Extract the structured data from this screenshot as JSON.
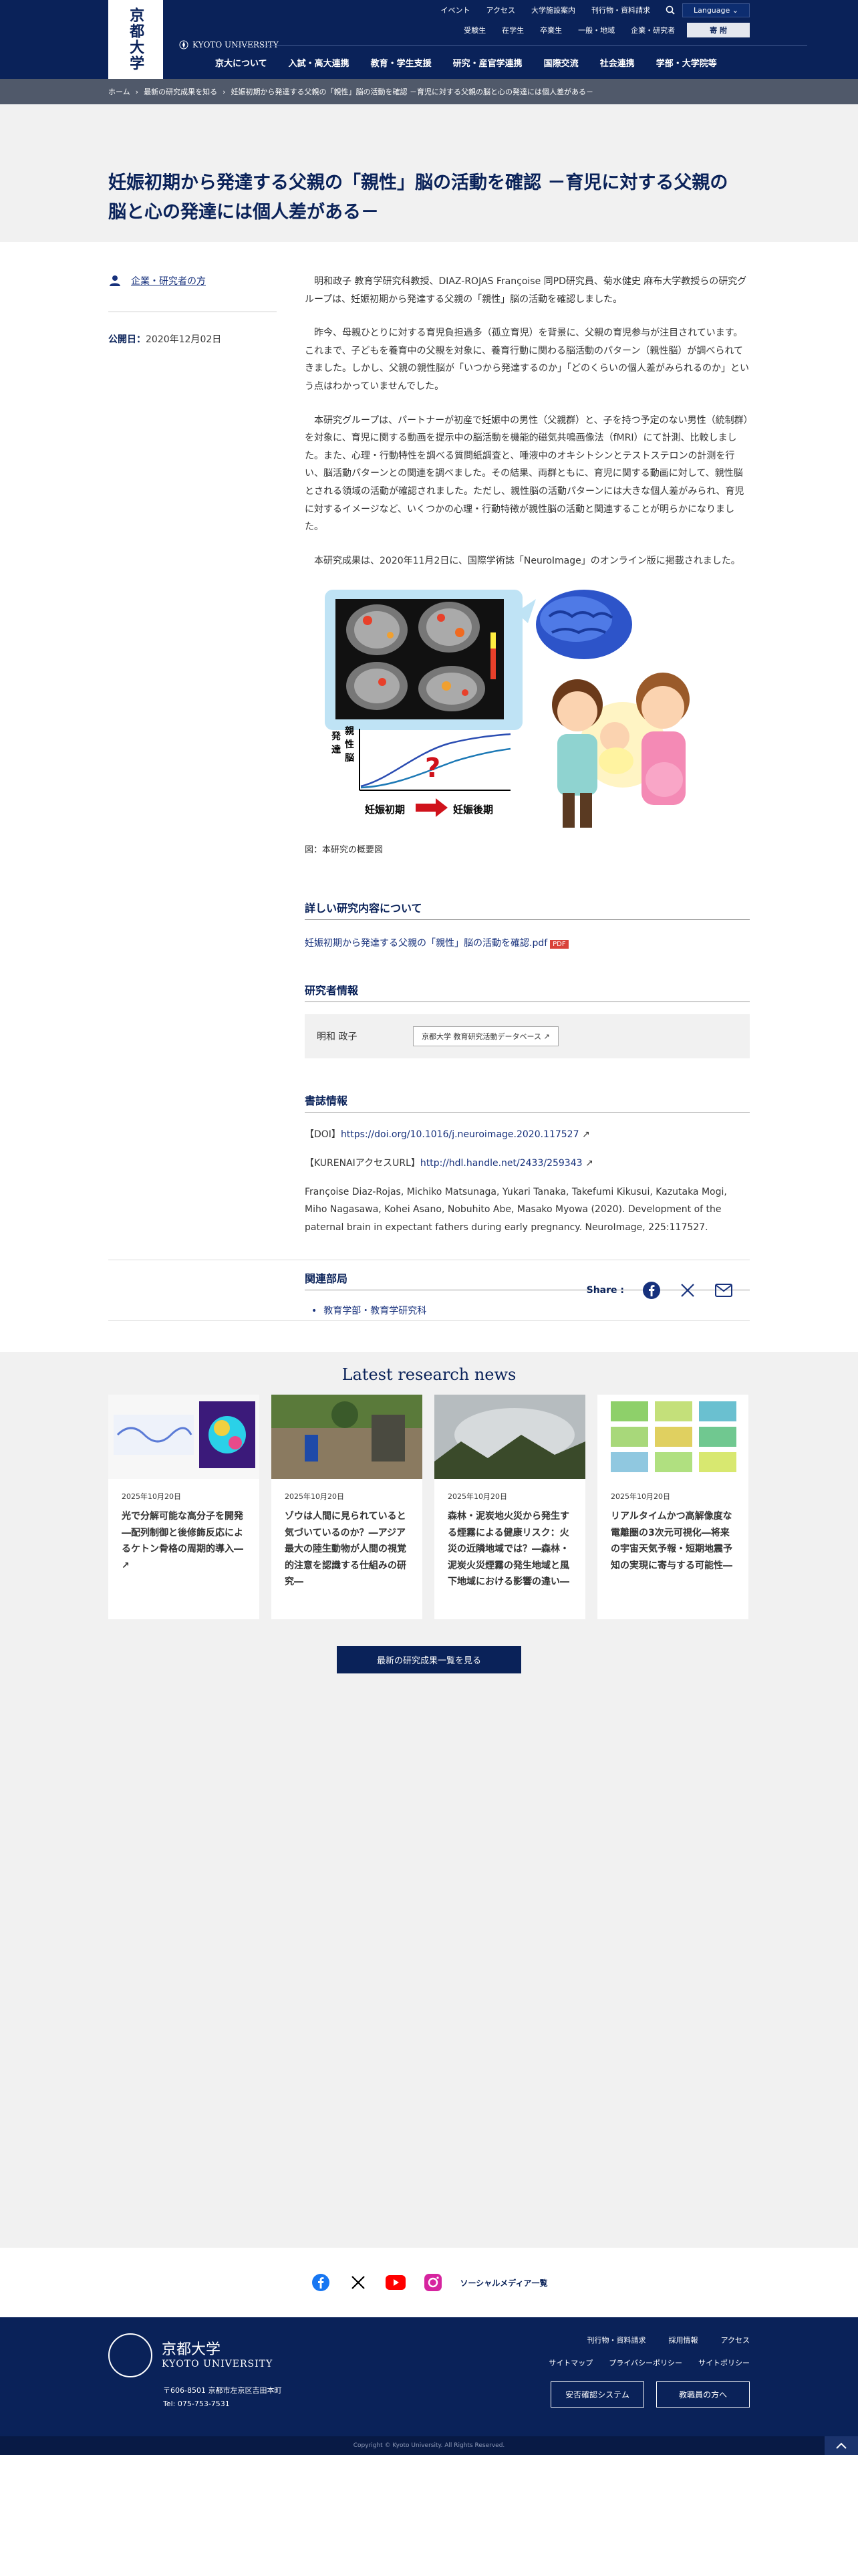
{
  "header": {
    "logo_text": "京都大学",
    "top_links": [
      "イベント",
      "アクセス",
      "大学施設案内",
      "刊行物・資料請求"
    ],
    "language_label": "Language",
    "audience_links": [
      "受験生",
      "在学生",
      "卒業生",
      "一般・地域",
      "企業・研究者"
    ],
    "donate_label": "寄 附",
    "brand_en": "KYOTO UNIVERSITY",
    "main_nav": [
      "京大について",
      "入試・高大連携",
      "教育・学生支援",
      "研究・産官学連携",
      "国際交流",
      "社会連携",
      "学部・大学院等"
    ]
  },
  "breadcrumb": [
    "ホーム",
    "最新の研究成果を知る",
    "妊娠初期から発達する父親の「親性」脳の活動を確認 －育児に対する父親の脳と心の発達には個人差がある－"
  ],
  "title_lines": [
    "妊娠初期から発達する父親の「親性」脳の活動を確認 －育児に対する父親の",
    "脳と心の発達には個人差がある－"
  ],
  "sidebar": {
    "audience_link": "企業・研究者の方",
    "pubdate_label": "公開日：",
    "pubdate_value": "2020年12月02日"
  },
  "paragraphs": [
    "明和政子 教育学研究科教授、DIAZ-ROJAS Françoise 同PD研究員、菊水健史 麻布大学教授らの研究グループは、妊娠初期から発達する父親の「親性」脳の活動を確認しました。",
    "昨今、母親ひとりに対する育児負担過多（孤立育児）を背景に、父親の育児参与が注目されています。これまで、子どもを養育中の父親を対象に、養育行動に関わる脳活動のパターン（親性脳）が調べられてきました。しかし、父親の親性脳が「いつから発達するのか」「どのくらいの個人差がみられるのか」という点はわかっていませんでした。",
    "本研究グループは、パートナーが初産で妊娠中の男性（父親群）と、子を持つ予定のない男性（統制群）を対象に、育児に関する動画を提示中の脳活動を機能的磁気共鳴画像法（fMRI）にて計測、比較しました。また、心理・行動特性を調べる質問紙調査と、唾液中のオキシトシンとテストステロンの計測を行い、脳活動パターンとの関連を調べました。その結果、両群ともに、育児に関する動画に対して、親性脳とされる領域の活動が確認されました。ただし、親性脳の活動パターンには大きな個人差がみられ、育児に対するイメージなど、いくつかの心理・行動特徴が親性脳の活動と関連することが明らかになりました。",
    "本研究成果は、2020年11月2日に、国際学術誌「NeuroImage」のオンライン版に掲載されました。"
  ],
  "figure": {
    "ylabel_chars": [
      "親",
      "性",
      "脳"
    ],
    "ylabel_side": [
      "発",
      "達"
    ],
    "x_start": "妊娠初期",
    "x_end": "妊娠後期",
    "question": "?",
    "caption": "図：本研究の概要図"
  },
  "sections": {
    "details_heading": "詳しい研究内容について",
    "details_link": "妊娠初期から発達する父親の「親性」脳の活動を確認.pdf",
    "pdf_tag": "PDF",
    "researcher_heading": "研究者情報",
    "researcher_name": "明和 政子",
    "researcher_db": "京都大学 教育研究活動データベース",
    "biblio_heading": "書誌情報",
    "doi_label": "【DOI】",
    "doi_url": "https://doi.org/10.1016/j.neuroimage.2020.117527",
    "kurenai_label": "【KURENAIアクセスURL】",
    "kurenai_url": "http://hdl.handle.net/2433/259343",
    "citation": "Françoise Diaz-Rojas, Michiko Matsunaga, Yukari Tanaka, Takefumi Kikusui, Kazutaka Mogi, Miho Nagasawa, Kohei Asano, Nobuhito Abe, Masako Myowa (2020). Development of the paternal brain in expectant fathers during early pregnancy. NeuroImage, 225:117527.",
    "dept_heading": "関連部局",
    "dept_item": "教育学部・教育学研究科"
  },
  "share": {
    "label": "Share :"
  },
  "latest": {
    "heading": "Latest research news",
    "cards": [
      {
        "date": "2025年10月20日",
        "title": "光で分解可能な高分子を開発―配列制御と後修飾反応によるケトン骨格の周期的導入―"
      },
      {
        "date": "2025年10月20日",
        "title": "ゾウは人間に見られていると気づいているのか？―アジア最大の陸生動物が人間の視覚的注意を認識する仕組みの研究―"
      },
      {
        "date": "2025年10月20日",
        "title": "森林・泥炭地火災から発生する煙霧による健康リスク：火災の近隣地域では？―森林・泥炭火災煙霧の発生地域と風下地域における影響の違い―"
      },
      {
        "date": "2025年10月20日",
        "title": "リアルタイムかつ高解像度な電離圏の3次元可視化―将来の宇宙天気予報・短期地震予知の実現に寄与する可能性―"
      }
    ],
    "more_button": "最新の研究成果一覧を見る"
  },
  "social": {
    "media_link": "ソーシャルメディア一覧"
  },
  "footer": {
    "name_jp": "京都大学",
    "name_en": "KYOTO UNIVERSITY",
    "address": "〒606-8501 京都市左京区吉田本町",
    "tel": "Tel: 075-753-7531",
    "links1": [
      "刊行物・資料請求",
      "採用情報",
      "アクセス"
    ],
    "links2": [
      "サイトマップ",
      "プライバシーポリシー",
      "サイトポリシー"
    ],
    "buttons": [
      "安否確認システム",
      "教職員の方へ"
    ],
    "copyright": "Copyright © Kyoto University. All Rights Reserved."
  },
  "colors": {
    "navy": "#0a2259",
    "breadcrumb": "#50596a",
    "band": "#f1f1f1",
    "pdf": "#d9423a"
  }
}
